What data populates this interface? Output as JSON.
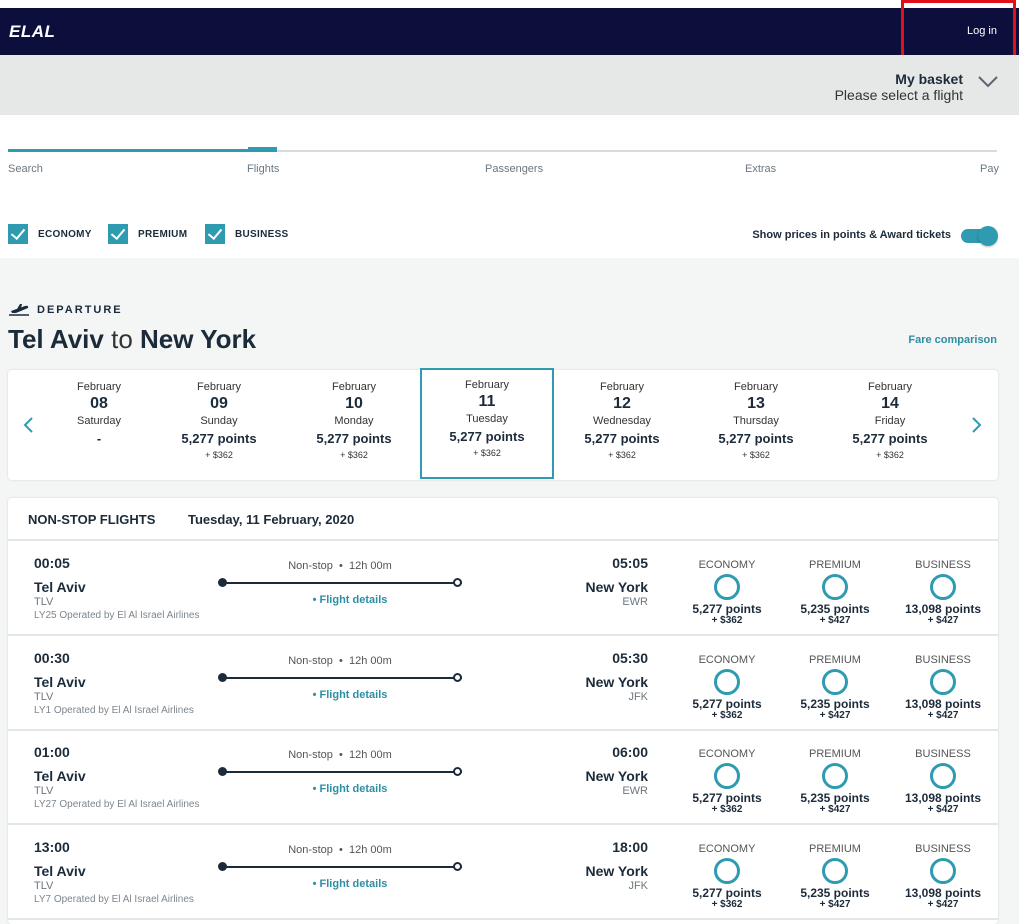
{
  "header": {
    "logo_text": "ELAL",
    "login_label": "Log in"
  },
  "basket": {
    "title": "My basket",
    "subtitle": "Please select a flight"
  },
  "progress": {
    "steps": [
      "Search",
      "Flights",
      "Passengers",
      "Extras",
      "Pay"
    ],
    "current": "Flights"
  },
  "filters": {
    "cabins": [
      {
        "label": "ECONOMY",
        "checked": true
      },
      {
        "label": "PREMIUM",
        "checked": true
      },
      {
        "label": "BUSINESS",
        "checked": true
      }
    ],
    "points_toggle_label": "Show prices in points & Award tickets",
    "points_toggle_on": true
  },
  "departure": {
    "label": "DEPARTURE",
    "origin": "Tel Aviv",
    "connector": "to",
    "destination": "New York",
    "fare_comparison": "Fare comparison"
  },
  "dates": [
    {
      "month": "February",
      "day": "08",
      "weekday": "Saturday",
      "points": "-",
      "cash": ""
    },
    {
      "month": "February",
      "day": "09",
      "weekday": "Sunday",
      "points": "5,277 points",
      "cash": "+ $362"
    },
    {
      "month": "February",
      "day": "10",
      "weekday": "Monday",
      "points": "5,277 points",
      "cash": "+ $362"
    },
    {
      "month": "February",
      "day": "11",
      "weekday": "Tuesday",
      "points": "5,277 points",
      "cash": "+ $362",
      "selected": true
    },
    {
      "month": "February",
      "day": "12",
      "weekday": "Wednesday",
      "points": "5,277 points",
      "cash": "+ $362"
    },
    {
      "month": "February",
      "day": "13",
      "weekday": "Thursday",
      "points": "5,277 points",
      "cash": "+ $362"
    },
    {
      "month": "February",
      "day": "14",
      "weekday": "Friday",
      "points": "5,277 points",
      "cash": "+ $362"
    }
  ],
  "list": {
    "title": "NON-STOP FLIGHTS",
    "date": "Tuesday, 11 February, 2020",
    "fare_labels": [
      "ECONOMY",
      "PREMIUM",
      "BUSINESS"
    ],
    "flights": [
      {
        "dep_time": "00:05",
        "dep_city": "Tel Aviv",
        "dep_code": "TLV",
        "operated": "LY25 Operated by El Al Israel Airlines",
        "stops": "Non-stop",
        "duration": "12h 00m",
        "details": "Flight details",
        "arr_time": "05:05",
        "arr_city": "New York",
        "arr_code": "EWR",
        "fares": [
          {
            "points": "5,277 points",
            "cash": "+ $362"
          },
          {
            "points": "5,235 points",
            "cash": "+ $427"
          },
          {
            "points": "13,098 points",
            "cash": "+ $427"
          }
        ]
      },
      {
        "dep_time": "00:30",
        "dep_city": "Tel Aviv",
        "dep_code": "TLV",
        "operated": "LY1 Operated by El Al Israel Airlines",
        "stops": "Non-stop",
        "duration": "12h 00m",
        "details": "Flight details",
        "arr_time": "05:30",
        "arr_city": "New York",
        "arr_code": "JFK",
        "fares": [
          {
            "points": "5,277 points",
            "cash": "+ $362"
          },
          {
            "points": "5,235 points",
            "cash": "+ $427"
          },
          {
            "points": "13,098 points",
            "cash": "+ $427"
          }
        ]
      },
      {
        "dep_time": "01:00",
        "dep_city": "Tel Aviv",
        "dep_code": "TLV",
        "operated": "LY27 Operated by El Al Israel Airlines",
        "stops": "Non-stop",
        "duration": "12h 00m",
        "details": "Flight details",
        "arr_time": "06:00",
        "arr_city": "New York",
        "arr_code": "EWR",
        "fares": [
          {
            "points": "5,277 points",
            "cash": "+ $362"
          },
          {
            "points": "5,235 points",
            "cash": "+ $427"
          },
          {
            "points": "13,098 points",
            "cash": "+ $427"
          }
        ]
      },
      {
        "dep_time": "13:00",
        "dep_city": "Tel Aviv",
        "dep_code": "TLV",
        "operated": "LY7 Operated by El Al Israel Airlines",
        "stops": "Non-stop",
        "duration": "12h 00m",
        "details": "Flight details",
        "arr_time": "18:00",
        "arr_city": "New York",
        "arr_code": "JFK",
        "fares": [
          {
            "points": "5,277 points",
            "cash": "+ $362"
          },
          {
            "points": "5,235 points",
            "cash": "+ $427"
          },
          {
            "points": "13,098 points",
            "cash": "+ $427"
          }
        ]
      }
    ]
  },
  "colors": {
    "header_bg": "#0c0f3c",
    "accent": "#2e9bb0",
    "highlight_box": "#e0111b"
  }
}
